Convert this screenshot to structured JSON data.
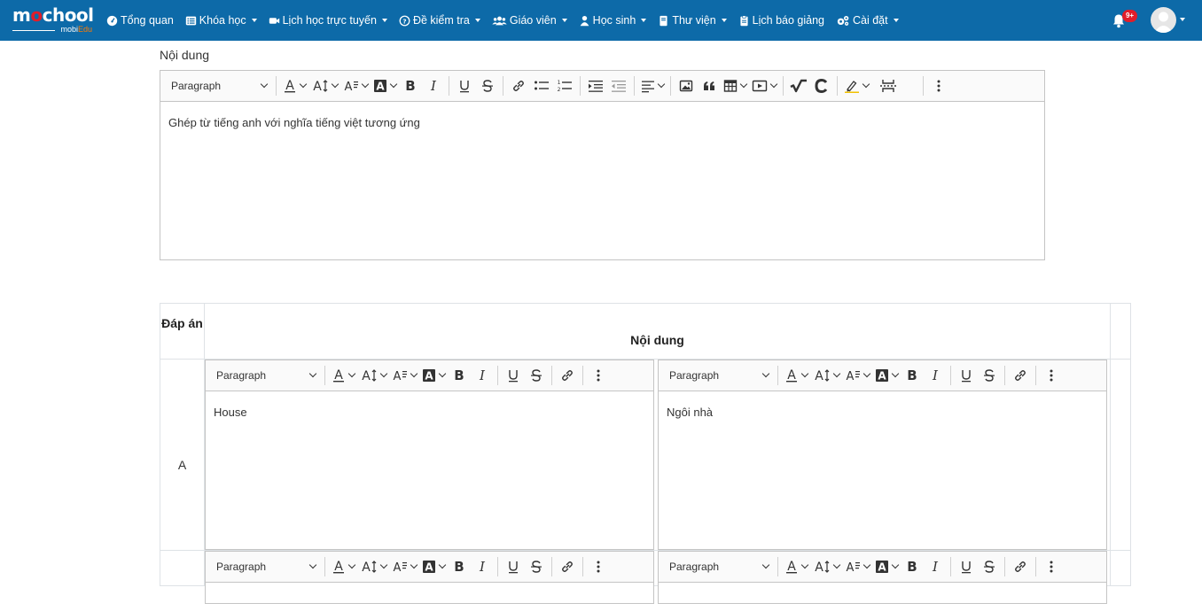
{
  "brand": {
    "logo_main_a": "m",
    "logo_main_o": "o",
    "logo_main_b": "chool",
    "logo_sub_a": "mobi",
    "logo_sub_b": "Edu"
  },
  "nav": {
    "items": [
      {
        "label": "Tổng quan",
        "icon": "dashboard-icon",
        "dropdown": false
      },
      {
        "label": "Khóa học",
        "icon": "list-icon",
        "dropdown": true
      },
      {
        "label": "Lịch học trực tuyến",
        "icon": "video-icon",
        "dropdown": true
      },
      {
        "label": "Đề kiểm tra",
        "icon": "question-circle-icon",
        "dropdown": true
      },
      {
        "label": "Giáo viên",
        "icon": "users-icon",
        "dropdown": true
      },
      {
        "label": "Học sinh",
        "icon": "user-icon",
        "dropdown": true
      },
      {
        "label": "Thư viện",
        "icon": "book-icon",
        "dropdown": true
      },
      {
        "label": "Lịch báo giảng",
        "icon": "clipboard-icon",
        "dropdown": false
      },
      {
        "label": "Cài đặt",
        "icon": "gears-icon",
        "dropdown": true
      }
    ],
    "notification_badge": "9+"
  },
  "question": {
    "label": "Nội dung",
    "paragraph_style": "Paragraph",
    "content": "Ghép từ tiếng anh với nghĩa tiếng việt tương ứng"
  },
  "answers_table": {
    "col_answer": "Đáp án",
    "col_content": "Nội dung",
    "rows": [
      {
        "letter": "A",
        "left_style": "Paragraph",
        "left_text": "House",
        "right_style": "Paragraph",
        "right_text": "Ngôi nhà"
      },
      {
        "letter": "",
        "left_style": "Paragraph",
        "left_text": "",
        "right_style": "Paragraph",
        "right_text": ""
      }
    ]
  },
  "colors": {
    "navbar": "#0d6aa8",
    "badge": "#e11d2a",
    "editor_border": "#c4c4c4"
  }
}
